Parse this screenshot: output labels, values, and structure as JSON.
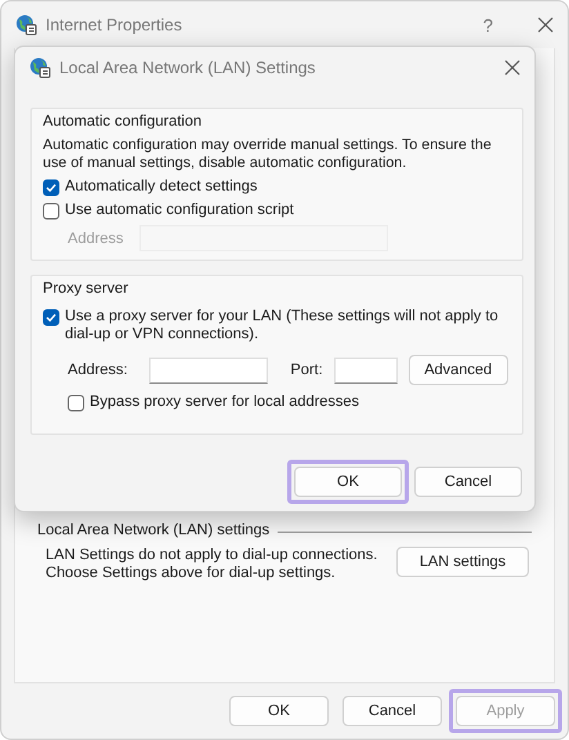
{
  "window": {
    "title": "Internet Properties",
    "help": "?"
  },
  "lan_section": {
    "title": "Local Area Network (LAN) settings",
    "description": "LAN Settings do not apply to dial-up connections.\nChoose Settings above for dial-up settings.",
    "button": "LAN settings"
  },
  "footer_buttons": [
    {
      "label": "OK",
      "disabled": false,
      "highlighted": false
    },
    {
      "label": "Cancel",
      "disabled": false,
      "highlighted": false
    },
    {
      "label": "Apply",
      "disabled": true,
      "highlighted": true
    }
  ],
  "dialog": {
    "title": "Local Area Network (LAN) Settings",
    "automatic": {
      "title": "Automatic configuration",
      "description": "Automatic configuration may override manual settings.  To ensure the use of manual settings, disable automatic configuration.",
      "options": [
        {
          "label": "Automatically detect settings",
          "checked": true
        },
        {
          "label": "Use automatic configuration script",
          "checked": false
        }
      ],
      "address": {
        "label": "Address",
        "disabled": true
      }
    },
    "proxy": {
      "title": "Proxy server",
      "use_proxy": {
        "label": "Use a proxy server for your LAN (These settings will not apply to dial-up or VPN connections).",
        "checked": true
      },
      "address_label": "Address:",
      "port_label": "Port:",
      "advanced": "Advanced",
      "bypass": {
        "label": "Bypass proxy server for local addresses",
        "checked": false
      }
    },
    "buttons": [
      {
        "label": "OK",
        "highlighted": true
      },
      {
        "label": "Cancel",
        "highlighted": false
      }
    ]
  }
}
